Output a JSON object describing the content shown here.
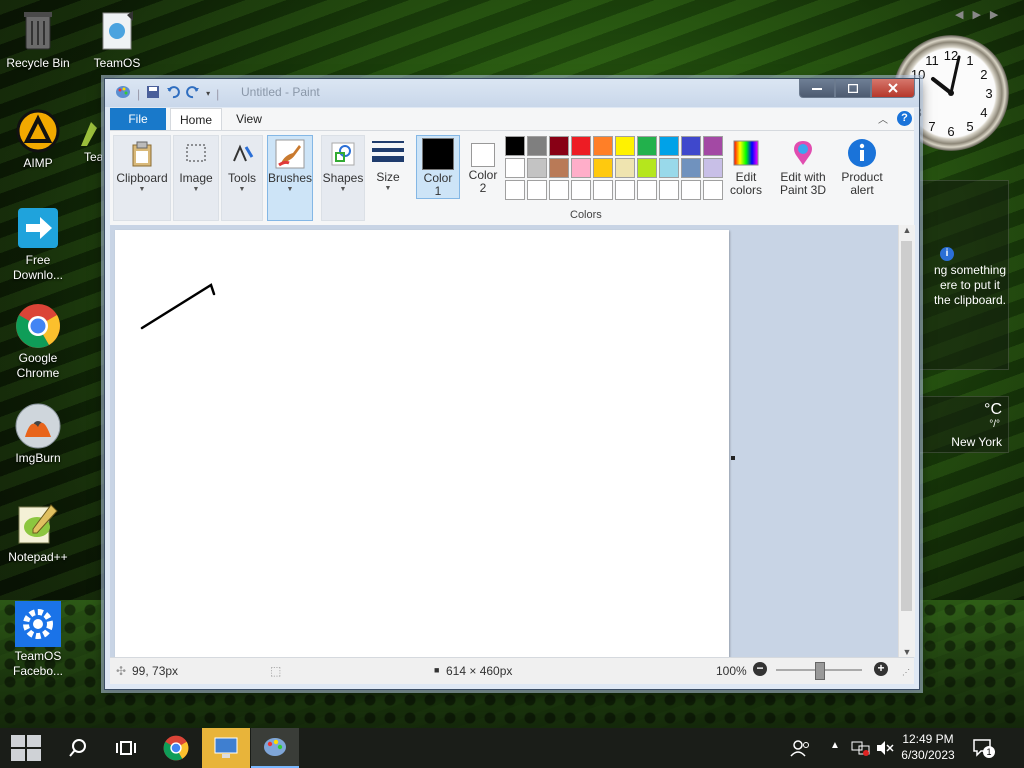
{
  "desktop": {
    "icons": [
      {
        "label": "Recycle Bin"
      },
      {
        "label": "TeamOS"
      },
      {
        "label": "AIMP"
      },
      {
        "label": "Tea"
      },
      {
        "label": "Free Downlo..."
      },
      {
        "label": "Google Chrome"
      },
      {
        "label": "ImgBurn"
      },
      {
        "label": "Notepad++"
      },
      {
        "label": "TeamOS Facebo..."
      }
    ]
  },
  "widgets": {
    "clipboard_note_lines": [
      "ng something",
      "ere to put it",
      "the clipboard."
    ],
    "weather_unit": "°C",
    "weather_value": "°/°",
    "weather_city": "New York"
  },
  "paint": {
    "title": "Untitled - Paint",
    "tabs": {
      "file": "File",
      "home": "Home",
      "view": "View"
    },
    "ribbon": {
      "clipboard": "Clipboard",
      "image": "Image",
      "tools": "Tools",
      "brushes": "Brushes",
      "shapes": "Shapes",
      "size": "Size",
      "color1": "Color 1",
      "color2": "Color 2",
      "edit_colors": "Edit colors",
      "edit_paint3d": "Edit with Paint 3D",
      "product_alert": "Product alert",
      "colors_group": "Colors"
    },
    "palette": [
      "#000000",
      "#7f7f7f",
      "#880015",
      "#ed1c24",
      "#ff7f27",
      "#fff200",
      "#22b14c",
      "#00a2e8",
      "#3f48cc",
      "#a349a4",
      "#ffffff",
      "#c3c3c3",
      "#b97a57",
      "#ffaec9",
      "#ffc90e",
      "#efe4b0",
      "#b5e61d",
      "#99d9ea",
      "#7092be",
      "#c8bfe7",
      "#ffffff",
      "#ffffff",
      "#ffffff",
      "#ffffff",
      "#ffffff",
      "#ffffff",
      "#ffffff",
      "#ffffff",
      "#ffffff",
      "#ffffff"
    ],
    "status": {
      "cursor_pos": "99, 73px",
      "image_size": "614 × 460px",
      "zoom": "100%",
      "zoom_fraction": 0.5
    }
  },
  "taskbar": {
    "time": "12:49 PM",
    "date": "6/30/2023",
    "notification_count": "1"
  },
  "clock": {
    "numbers": [
      "12",
      "1",
      "2",
      "3",
      "4",
      "5",
      "6",
      "7",
      "8",
      "9",
      "10",
      "11"
    ]
  }
}
